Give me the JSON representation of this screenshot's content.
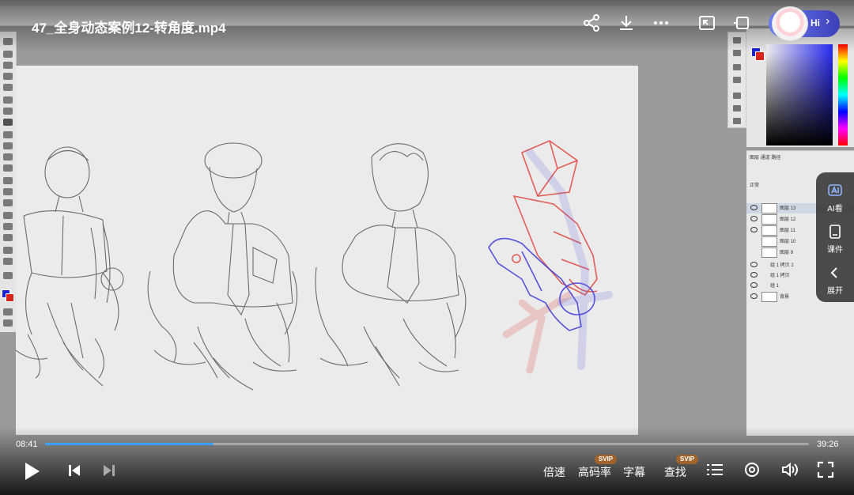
{
  "video": {
    "title": "47_全身动态案例12-转角度.mp4",
    "time_current": "08:41",
    "time_total": "39:26",
    "progress": 0.22
  },
  "assistant": {
    "greeting": "Hi"
  },
  "side_panel": {
    "items": [
      {
        "label": "AI看",
        "icon": "ai-view-icon"
      },
      {
        "label": "课件",
        "icon": "courseware-icon"
      },
      {
        "label": "展开",
        "icon": "chevron-left-icon"
      }
    ]
  },
  "controls": {
    "speed": "倍速",
    "quality": "高码率",
    "quality_badge": "SVIP",
    "subtitles": "字幕",
    "search": "查找",
    "search_badge": "SVIP"
  },
  "layers": {
    "tabs": "图层  通道  路径",
    "mode": "正常",
    "items": [
      {
        "name": "图层 13"
      },
      {
        "name": "图层 12"
      },
      {
        "name": "图层 11"
      },
      {
        "name": "图层 10"
      },
      {
        "name": "图层 9"
      },
      {
        "name": "组 1 拷贝 2"
      },
      {
        "name": "组 1 拷贝"
      },
      {
        "name": "组 1"
      },
      {
        "name": "背景"
      }
    ]
  },
  "colors": {
    "foreground": "#1a22d8",
    "background": "#d8251b",
    "progress": "#3aa0ff"
  }
}
